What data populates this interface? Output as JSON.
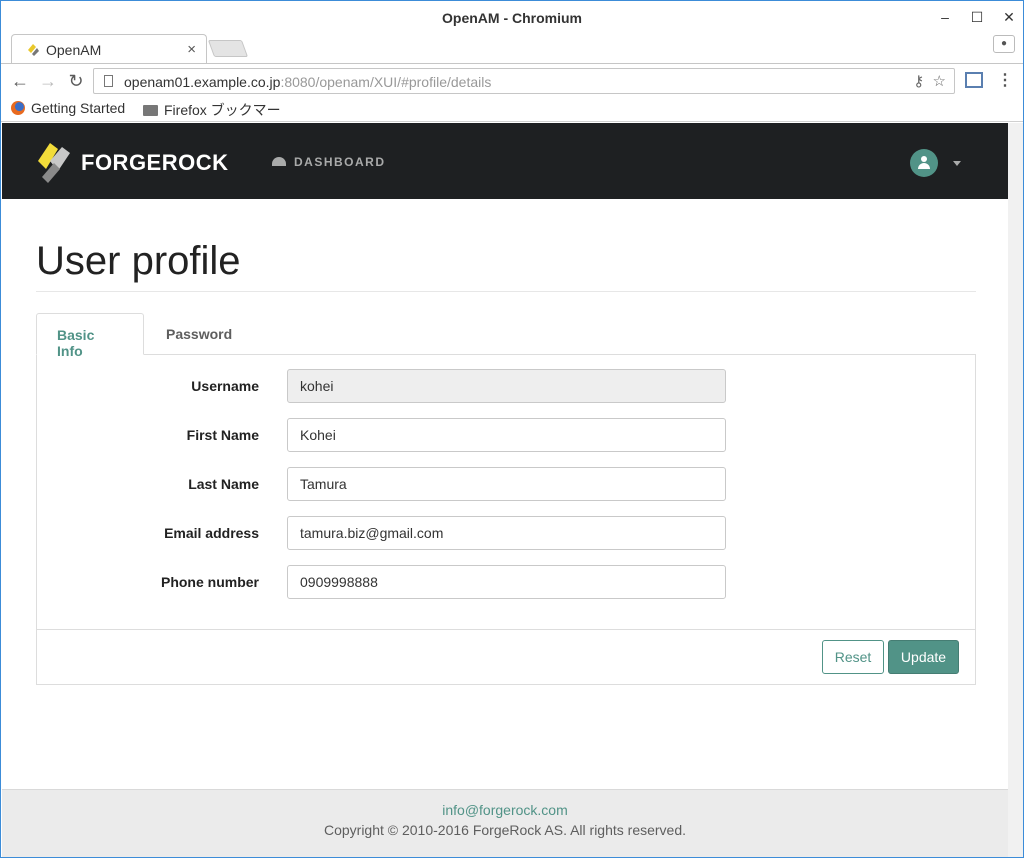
{
  "window": {
    "title": "OpenAM - Chromium"
  },
  "browser": {
    "tab_label": "OpenAM",
    "url_host": "openam01.example.co.jp",
    "url_rest": ":8080/openam/XUI/#profile/details",
    "bookmarks": [
      "Getting Started",
      "Firefox ブックマー"
    ]
  },
  "app": {
    "brand": "FORGEROCK",
    "nav_dashboard": "DASHBOARD",
    "page_title": "User profile",
    "tabs": [
      "Basic Info",
      "Password"
    ],
    "form": {
      "fields": [
        {
          "label": "Username",
          "value": "kohei"
        },
        {
          "label": "First Name",
          "value": "Kohei"
        },
        {
          "label": "Last Name",
          "value": "Tamura"
        },
        {
          "label": "Email address",
          "value": "tamura.biz@gmail.com"
        },
        {
          "label": "Phone number",
          "value": "0909998888"
        }
      ],
      "reset_label": "Reset",
      "update_label": "Update"
    },
    "footer": {
      "email": "info@forgerock.com",
      "copyright": "Copyright © 2010-2016 ForgeRock AS. All rights reserved."
    },
    "colors": {
      "accent": "#519387",
      "nav_bg": "#1e2022",
      "logo_yellow": "#f2dc3a"
    }
  },
  "icons": [
    "back-arrow-icon",
    "forward-arrow-icon",
    "reload-icon",
    "page-icon",
    "key-icon",
    "star-icon",
    "cast-icon",
    "menu-icon",
    "dashboard-gauge-icon",
    "user-icon",
    "caret-down-icon",
    "firefox-icon",
    "folder-icon",
    "close-icon"
  ]
}
